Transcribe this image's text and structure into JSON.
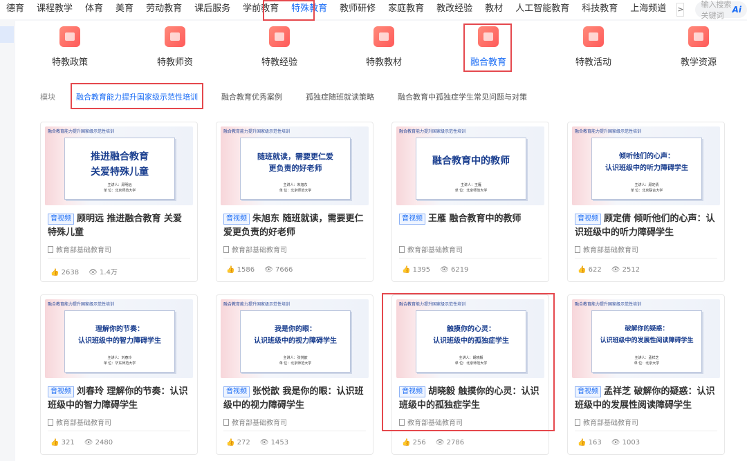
{
  "topnav": {
    "items": [
      "德育",
      "课程教学",
      "体育",
      "美育",
      "劳动教育",
      "课后服务",
      "学前教育",
      "特殊教育",
      "教师研修",
      "家庭教育",
      "教改经验",
      "教材",
      "人工智能教育",
      "科技教育",
      "上海频道"
    ],
    "active_index": 7,
    "more": ">",
    "search_placeholder": "输入搜索关键词",
    "ai_label": "Ai"
  },
  "categories": [
    "特教政策",
    "特教师资",
    "特教经验",
    "特教教材",
    "融合教育",
    "特教活动",
    "教学资源"
  ],
  "active_category_index": 4,
  "tabs": {
    "lead": "模块",
    "items": [
      "融合教育能力提升国家级示范性培训",
      "融合教育优秀案例",
      "孤独症随班就读策略",
      "融合教育中孤独症学生常见问题与对策"
    ],
    "selected_index": 0
  },
  "cards": [
    {
      "thumb_header": "融合教育能力提升国家级示范性培训",
      "thumb_title": "推进融合教育\n关爱特殊儿童",
      "thumb_meta": "主讲人：顾明远\n单  位：北京师范大学",
      "badge": "音视频",
      "title": "顾明远 推进融合教育 关爱特殊儿童",
      "org": "教育部基础教育司",
      "likes": "2638",
      "views": "1.4万"
    },
    {
      "thumb_header": "融合教育能力提升国家级示范性培训",
      "thumb_title": "随班就读，需要更仁爱\n更负责的好老师",
      "thumb_meta": "主讲人：朱旭东\n单  位：北京师范大学",
      "badge": "音视频",
      "title": "朱旭东 随班就读，需要更仁爱更负责的好老师",
      "org": "教育部基础教育司",
      "likes": "1586",
      "views": "7666"
    },
    {
      "thumb_header": "融合教育能力提升国家级示范性培训",
      "thumb_title": "融合教育中的教师",
      "thumb_meta": "主讲人：王雁\n单  位：北京师范大学",
      "badge": "音视频",
      "title": "王雁 融合教育中的教师",
      "org": "教育部基础教育司",
      "likes": "1395",
      "views": "6219"
    },
    {
      "thumb_header": "融合教育能力提升国家级示范性培训",
      "thumb_title": "倾听他们的心声：\n认识班级中的听力障碍学生",
      "thumb_meta": "主讲人：顾定倩\n单  位：北京联合大学",
      "badge": "音视频",
      "title": "顾定倩 倾听他们的心声：认识班级中的听力障碍学生",
      "org": "教育部基础教育司",
      "likes": "622",
      "views": "2512"
    },
    {
      "thumb_header": "融合教育能力提升国家级示范性培训",
      "thumb_title": "理解你的节奏：\n认识班级中的智力障碍学生",
      "thumb_meta": "主讲人：刘春玲\n单  位：华东师范大学",
      "badge": "音视频",
      "title": "刘春玲 理解你的节奏：认识班级中的智力障碍学生",
      "org": "教育部基础教育司",
      "likes": "321",
      "views": "2480"
    },
    {
      "thumb_header": "融合教育能力提升国家级示范性培训",
      "thumb_title": "我是你的眼：\n认识班级中的视力障碍学生",
      "thumb_meta": "主讲人：张悦歆\n单  位：北京师范大学",
      "badge": "音视频",
      "title": "张悦歆 我是你的眼：认识班级中的视力障碍学生",
      "org": "教育部基础教育司",
      "likes": "272",
      "views": "1453"
    },
    {
      "thumb_header": "融合教育能力提升国家级示范性培训",
      "thumb_title": "触摸你的心灵：\n认识班级中的孤独症学生",
      "thumb_meta": "主讲人：胡晓毅\n单  位：北京师范大学",
      "badge": "音视频",
      "title": "胡晓毅 触摸你的心灵：认识班级中的孤独症学生",
      "org": "教育部基础教育司",
      "likes": "256",
      "views": "2786"
    },
    {
      "thumb_header": "融合教育能力提升国家级示范性培训",
      "thumb_title": "破解你的疑惑：\n认识班级中的发展性阅读障碍学生",
      "thumb_meta": "主讲人：孟祥芝\n单  位：北京大学",
      "badge": "音视频",
      "title": "孟祥芝 破解你的疑惑：认识班级中的发展性阅读障碍学生",
      "org": "教育部基础教育司",
      "likes": "163",
      "views": "1003"
    }
  ],
  "colors": {
    "accent": "#1a6cf5",
    "highlight": "#e5484d"
  }
}
